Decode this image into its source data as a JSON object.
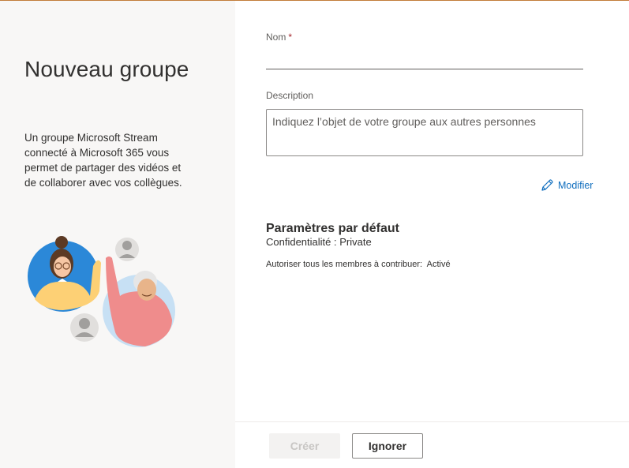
{
  "panel": {
    "title": "Nouveau groupe",
    "description": "Un groupe Microsoft Stream connecté à Microsoft 365 vous permet de partager des vidéos et de collaborer avec vos collègues."
  },
  "form": {
    "name_label": "Nom",
    "name_required_mark": "*",
    "name_value": "",
    "description_label": "Description",
    "description_placeholder": "Indiquez l’objet de votre groupe aux autres personnes",
    "modify_label": "Modifier"
  },
  "settings": {
    "title": "Paramètres par défaut",
    "privacy_label": "Confidentialité",
    "privacy_value": "Private",
    "contribute_label": "Autoriser tous les membres à contribuer:",
    "contribute_value": "Activé"
  },
  "footer": {
    "create_label": "Créer",
    "ignore_label": "Ignorer"
  },
  "colors": {
    "accent": "#106ebe",
    "required": "#a4262c",
    "panel_background": "#f8f7f6"
  },
  "icons": {
    "modify": "pencil-icon"
  }
}
